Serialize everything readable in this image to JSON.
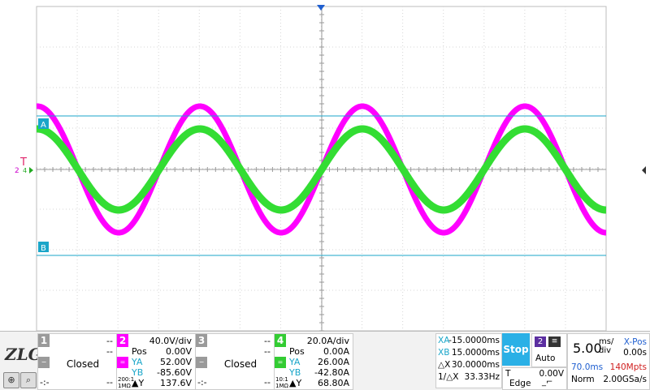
{
  "markers": {
    "a": "A",
    "b": "B",
    "trig": "T",
    "ch_left": "2",
    "ch_left_sub": "4"
  },
  "ch1": {
    "num": "1",
    "line1": "--",
    "line2": "--",
    "closed": "Closed",
    "bottom_left": "-:-",
    "bottom_right": "--",
    "color": "#9a9a9a"
  },
  "ch2": {
    "num": "2",
    "scale": "40.0V/div",
    "pos_label": "Pos",
    "pos": "0.00V",
    "ya_label": "YA",
    "ya": "52.00V",
    "yb_label": "YB",
    "yb": "-85.60V",
    "dy_label": "▲Y",
    "dy": "137.6V",
    "badge_top": "200:1",
    "badge_bottom": "1MΩ",
    "color": "#ff00ff"
  },
  "ch3": {
    "num": "3",
    "line1": "--",
    "line2": "--",
    "closed": "Closed",
    "bottom_left": "-:-",
    "bottom_right": "--",
    "color": "#9a9a9a"
  },
  "ch4": {
    "num": "4",
    "scale": "20.0A/div",
    "pos_label": "Pos",
    "pos": "0.00A",
    "ya_label": "YA",
    "ya": "26.00A",
    "yb_label": "YB",
    "yb": "-42.80A",
    "dy_label": "▲Y",
    "dy": "68.80A",
    "badge_top": "10:1",
    "badge_bottom": "1MΩ",
    "color": "#33cc33"
  },
  "measure": {
    "xa_label": "XA",
    "xa": "-15.0000ms",
    "xb_label": "XB",
    "xb": "15.0000ms",
    "dx_label": "△X",
    "dx": "30.0000ms",
    "f_label": "1/△X",
    "f": "33.33Hz"
  },
  "run_state": "Stop",
  "trigger": {
    "source": "2",
    "mode": "Auto",
    "t_label": "T",
    "level": "0.00V",
    "type": "Edge"
  },
  "timebase": {
    "value": "5.00",
    "unit_top": "ms/",
    "unit_bottom": "div",
    "xpos_label": "X-Pos",
    "xpos": "0.00s",
    "window": "70.0ms",
    "points": "140Mpts",
    "acq": "Norm",
    "rate": "2.00GSa/s"
  },
  "colors": {
    "ch2": "#ff00ff",
    "ch4": "#33dd33",
    "cursor": "#1aa6c9",
    "grid": "#c8c8c8",
    "accent": "#2ab0e6"
  },
  "icons": {
    "logo": "ZLG",
    "zoom": "zoom-icon",
    "search": "search-icon",
    "trigger_edge": "rising-edge-icon"
  }
}
